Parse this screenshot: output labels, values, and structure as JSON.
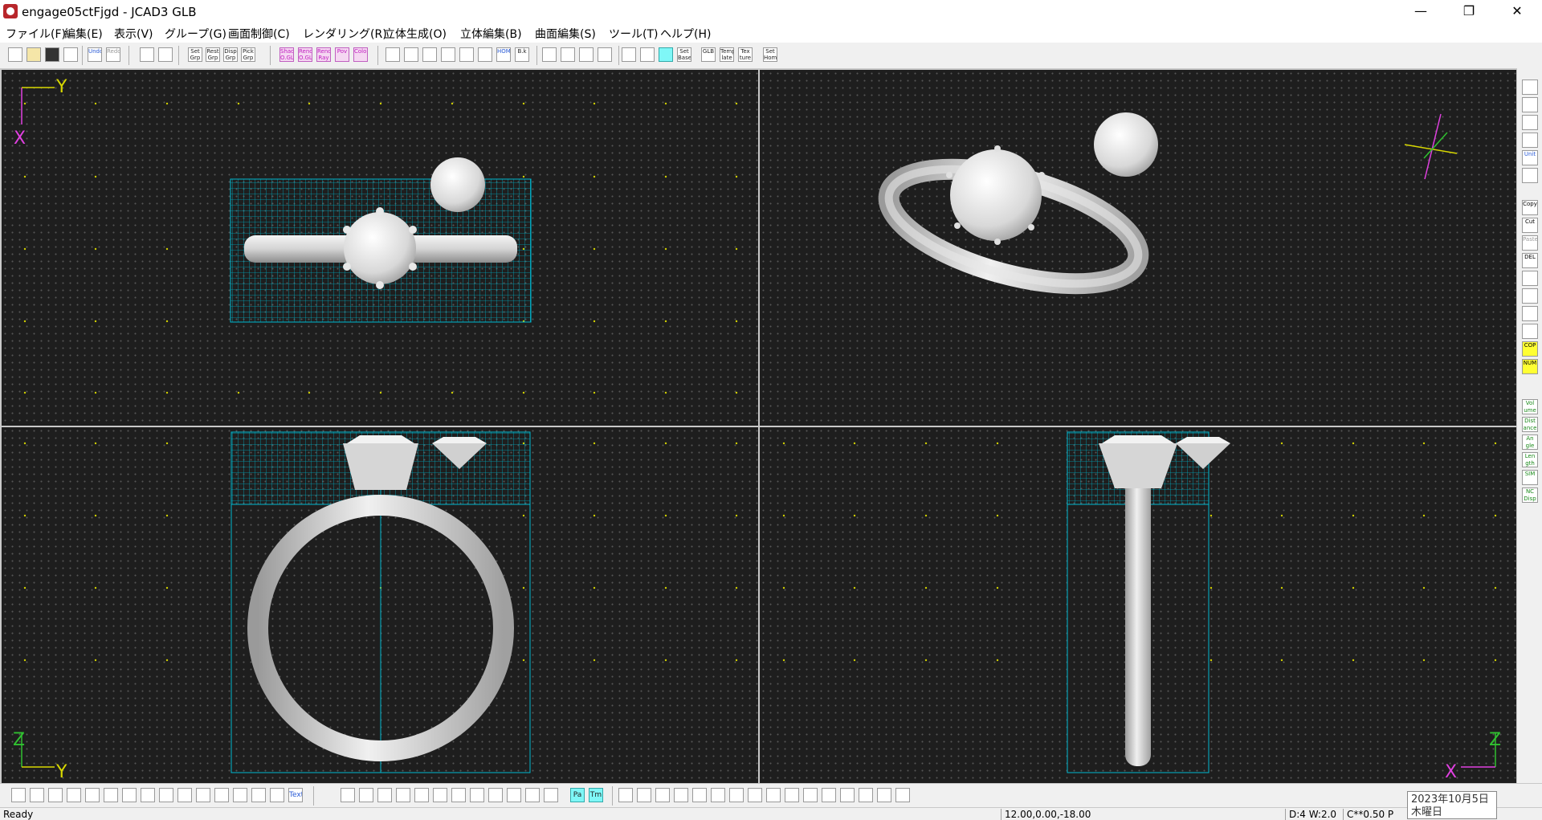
{
  "window": {
    "title": "engage05ctFjgd - JCAD3 GLB",
    "minimize": "—",
    "restore": "❐",
    "close": "✕"
  },
  "menu": [
    "ファイル(F)",
    "編集(E)",
    "表示(V)",
    "グループ(G)",
    "画面制御(C)",
    "レンダリング(R)",
    "立体生成(O)",
    "立体編集(B)",
    "曲面編集(S)",
    "ツール(T)",
    "ヘルプ(H)"
  ],
  "toolbar": {
    "undo": "Undo",
    "redo": "Redo",
    "set_grp": "Set Grp",
    "rest_grp": "Rest Grp",
    "disp_grp": "Disp Grp",
    "pick_grp": "Pick Grp",
    "shad_ogl": "Shad O.GL",
    "rend_ogl": "Rend O.GL",
    "rend_ray": "Rend Ray",
    "pov": "Pov",
    "color": "Color",
    "home": "HOME",
    "back": "B.k",
    "set_base": "Set Base",
    "glb": "GLB",
    "temp_late": "Temp late",
    "tex_ture": "Tex ture",
    "set_home": "Set Home"
  },
  "viewports": {
    "top": {
      "axis_h": "Y",
      "axis_v": "X"
    },
    "front": {
      "axis_h": "Y",
      "axis_v": "Z"
    },
    "side": {
      "axis_h": "X",
      "axis_v": "Z"
    }
  },
  "right_panel": {
    "unit": "Unit",
    "copy": "Copy",
    "cut": "Cut",
    "paste": "Paste",
    "del": "DEL",
    "cop": "COP",
    "num": "NUM",
    "volume": "Vol ume",
    "distance": "Dist ance",
    "angle": "An gle",
    "length": "Len gth",
    "sim": "SIM",
    "nc_disp": "NC Disp"
  },
  "bottom_toolbar": {
    "text": "Text",
    "pa": "Pa",
    "tm": "Tm"
  },
  "status": {
    "message": "Ready",
    "coords": "12.00,0.00,-18.00",
    "dw": "D:4 W:2.0",
    "cl": "C**0.50 P"
  },
  "tooltip": {
    "date": "2023年10月5日",
    "weekday": "木曜日"
  },
  "colors": {
    "viewport_bg": "#1e1e1e",
    "grid_cyan": "#00b0c8",
    "axis_yellow": "#d8d800",
    "axis_magenta": "#e040e0",
    "axis_green": "#30c030",
    "metal": "#cfcfcf"
  }
}
